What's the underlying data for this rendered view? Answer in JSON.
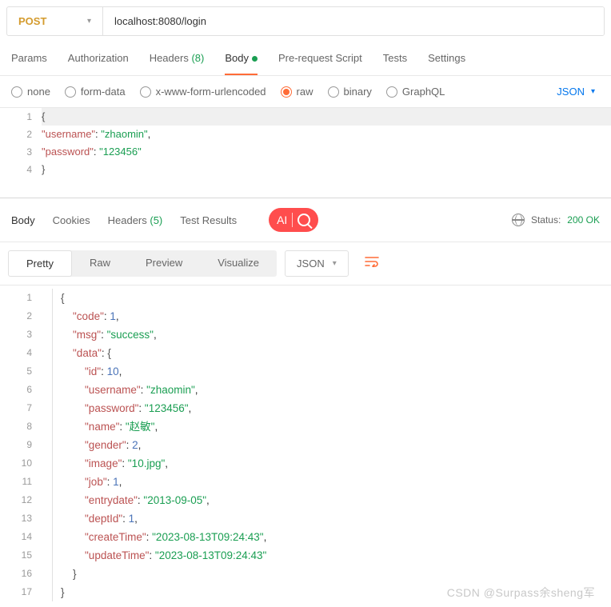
{
  "request": {
    "method": "POST",
    "url": "localhost:8080/login"
  },
  "req_tabs": {
    "params": "Params",
    "auth": "Authorization",
    "headers": "Headers",
    "headers_count": "(8)",
    "body": "Body",
    "prereq": "Pre-request Script",
    "tests": "Tests",
    "settings": "Settings"
  },
  "body_types": {
    "none": "none",
    "formdata": "form-data",
    "urlencoded": "x-www-form-urlencoded",
    "raw": "raw",
    "binary": "binary",
    "graphql": "GraphQL"
  },
  "lang": "JSON",
  "req_code": {
    "l1": "{",
    "l2a": "\"username\"",
    "l2b": ": ",
    "l2c": "\"zhaomin\"",
    "l2d": ",",
    "l3a": "\"password\"",
    "l3b": ": ",
    "l3c": "\"123456\"",
    "l4": "}"
  },
  "resp_tabs": {
    "body": "Body",
    "cookies": "Cookies",
    "headers": "Headers",
    "headers_count": "(5)",
    "test_results": "Test Results"
  },
  "status": {
    "label": "Status:",
    "code": "200 OK"
  },
  "view_tabs": {
    "pretty": "Pretty",
    "raw": "Raw",
    "preview": "Preview",
    "visualize": "Visualize"
  },
  "fmt": "JSON",
  "overlay": {
    "ai": "AI"
  },
  "watermark": "CSDN @Surpass余sheng军",
  "resp_lines": [
    {
      "n": 1,
      "tokens": [
        {
          "t": "{",
          "c": "bracket"
        }
      ],
      "indent": 0
    },
    {
      "n": 2,
      "tokens": [
        {
          "t": "\"code\"",
          "c": "key"
        },
        {
          "t": ": ",
          "c": ""
        },
        {
          "t": "1",
          "c": "num"
        },
        {
          "t": ",",
          "c": ""
        }
      ],
      "indent": 1
    },
    {
      "n": 3,
      "tokens": [
        {
          "t": "\"msg\"",
          "c": "key"
        },
        {
          "t": ": ",
          "c": ""
        },
        {
          "t": "\"success\"",
          "c": "string"
        },
        {
          "t": ",",
          "c": ""
        }
      ],
      "indent": 1
    },
    {
      "n": 4,
      "tokens": [
        {
          "t": "\"data\"",
          "c": "key"
        },
        {
          "t": ": ",
          "c": ""
        },
        {
          "t": "{",
          "c": "bracket"
        }
      ],
      "indent": 1
    },
    {
      "n": 5,
      "tokens": [
        {
          "t": "\"id\"",
          "c": "key"
        },
        {
          "t": ": ",
          "c": ""
        },
        {
          "t": "10",
          "c": "num"
        },
        {
          "t": ",",
          "c": ""
        }
      ],
      "indent": 2
    },
    {
      "n": 6,
      "tokens": [
        {
          "t": "\"username\"",
          "c": "key"
        },
        {
          "t": ": ",
          "c": ""
        },
        {
          "t": "\"zhaomin\"",
          "c": "string"
        },
        {
          "t": ",",
          "c": ""
        }
      ],
      "indent": 2
    },
    {
      "n": 7,
      "tokens": [
        {
          "t": "\"password\"",
          "c": "key"
        },
        {
          "t": ": ",
          "c": ""
        },
        {
          "t": "\"123456\"",
          "c": "string"
        },
        {
          "t": ",",
          "c": ""
        }
      ],
      "indent": 2
    },
    {
      "n": 8,
      "tokens": [
        {
          "t": "\"name\"",
          "c": "key"
        },
        {
          "t": ": ",
          "c": ""
        },
        {
          "t": "\"赵敏\"",
          "c": "string"
        },
        {
          "t": ",",
          "c": ""
        }
      ],
      "indent": 2
    },
    {
      "n": 9,
      "tokens": [
        {
          "t": "\"gender\"",
          "c": "key"
        },
        {
          "t": ": ",
          "c": ""
        },
        {
          "t": "2",
          "c": "num"
        },
        {
          "t": ",",
          "c": ""
        }
      ],
      "indent": 2
    },
    {
      "n": 10,
      "tokens": [
        {
          "t": "\"image\"",
          "c": "key"
        },
        {
          "t": ": ",
          "c": ""
        },
        {
          "t": "\"10.jpg\"",
          "c": "string"
        },
        {
          "t": ",",
          "c": ""
        }
      ],
      "indent": 2
    },
    {
      "n": 11,
      "tokens": [
        {
          "t": "\"job\"",
          "c": "key"
        },
        {
          "t": ": ",
          "c": ""
        },
        {
          "t": "1",
          "c": "num"
        },
        {
          "t": ",",
          "c": ""
        }
      ],
      "indent": 2
    },
    {
      "n": 12,
      "tokens": [
        {
          "t": "\"entrydate\"",
          "c": "key"
        },
        {
          "t": ": ",
          "c": ""
        },
        {
          "t": "\"2013-09-05\"",
          "c": "string"
        },
        {
          "t": ",",
          "c": ""
        }
      ],
      "indent": 2
    },
    {
      "n": 13,
      "tokens": [
        {
          "t": "\"deptId\"",
          "c": "key"
        },
        {
          "t": ": ",
          "c": ""
        },
        {
          "t": "1",
          "c": "num"
        },
        {
          "t": ",",
          "c": ""
        }
      ],
      "indent": 2
    },
    {
      "n": 14,
      "tokens": [
        {
          "t": "\"createTime\"",
          "c": "key"
        },
        {
          "t": ": ",
          "c": ""
        },
        {
          "t": "\"2023-08-13T09:24:43\"",
          "c": "string"
        },
        {
          "t": ",",
          "c": ""
        }
      ],
      "indent": 2
    },
    {
      "n": 15,
      "tokens": [
        {
          "t": "\"updateTime\"",
          "c": "key"
        },
        {
          "t": ": ",
          "c": ""
        },
        {
          "t": "\"2023-08-13T09:24:43\"",
          "c": "string"
        }
      ],
      "indent": 2
    },
    {
      "n": 16,
      "tokens": [
        {
          "t": "}",
          "c": "bracket"
        }
      ],
      "indent": 1
    },
    {
      "n": 17,
      "tokens": [
        {
          "t": "}",
          "c": "bracket"
        }
      ],
      "indent": 0
    }
  ]
}
